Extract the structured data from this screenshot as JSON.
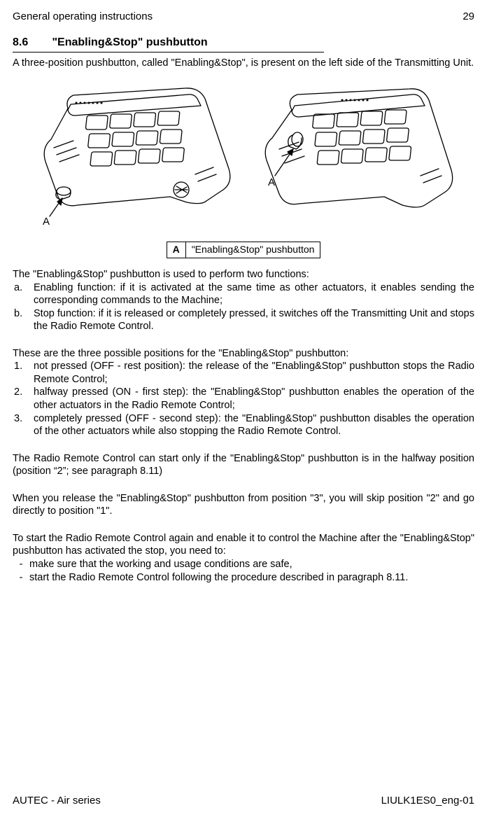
{
  "header": {
    "left": "General operating instructions",
    "right": "29"
  },
  "footer": {
    "left": "AUTEC - Air series",
    "right": "LIULK1ES0_eng-01"
  },
  "section": {
    "number": "8.6",
    "title": "\"Enabling&Stop\" pushbutton"
  },
  "intro": "A three-position pushbutton, called \"Enabling&Stop\", is present on the left side of the Transmitting Unit.",
  "figure": {
    "labelA_left": "A",
    "labelA_right": "A"
  },
  "legend": {
    "key": "A",
    "desc": "\"Enabling&Stop\" pushbutton"
  },
  "body1": "The \"Enabling&Stop\" pushbutton is used to perform two functions:",
  "listA": [
    {
      "label": "a.",
      "text": "Enabling function: if it is activated at the same time as other actuators, it enables sending the corresponding commands to the Machine;"
    },
    {
      "label": "b.",
      "text": "Stop function: if it is released or completely pressed, it switches off the Transmitting Unit and stops the Radio Remote Control."
    }
  ],
  "body2": "These are the three possible positions for the \"Enabling&Stop\" pushbutton:",
  "listB": [
    {
      "label": "1.",
      "text": "not pressed (OFF - rest position): the release of the \"Enabling&Stop\" pushbutton stops the Radio Remote Control;"
    },
    {
      "label": "2.",
      "text": "halfway pressed (ON - first step): the \"Enabling&Stop\" pushbutton enables the operation of the other actuators in the Radio Remote Control;"
    },
    {
      "label": "3.",
      "text": "completely pressed (OFF - second step): the \"Enabling&Stop\" pushbutton disables the operation of the other actuators while also stopping the Radio Remote Control."
    }
  ],
  "body3": "The Radio Remote Control can start only if the \"Enabling&Stop\" pushbutton is in the halfway position (position “2”; see paragraph 8.11)",
  "body4": "When you release the \"Enabling&Stop\" pushbutton from position \"3\", you will skip position \"2\" and go directly to position \"1\".",
  "body5": "To start the Radio Remote Control again and enable it to control the Machine after the \"Enabling&Stop\" pushbutton has activated the stop, you need to:",
  "listC": [
    {
      "label": "-",
      "text": "make sure that the working and usage conditions are safe,"
    },
    {
      "label": "-",
      "text": "start the Radio Remote Control following the procedure described in paragraph 8.11."
    }
  ]
}
